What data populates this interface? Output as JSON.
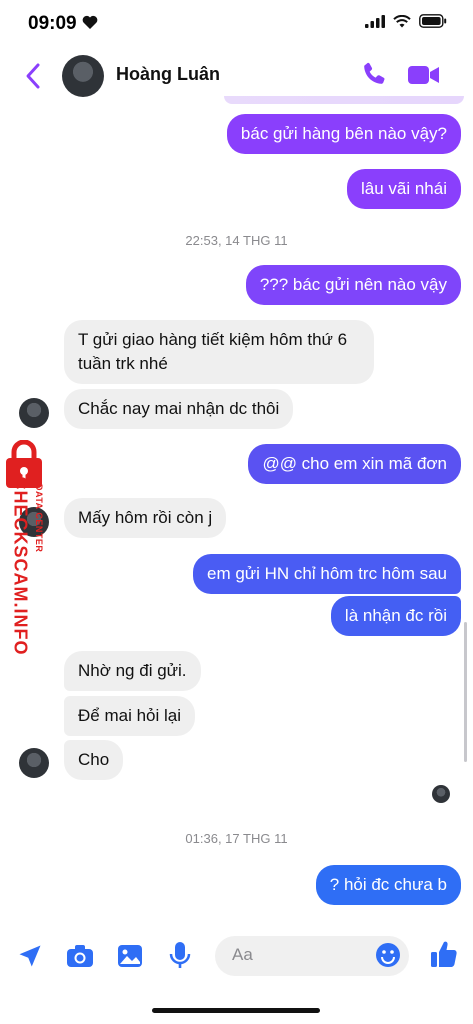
{
  "status_bar": {
    "time": "09:09"
  },
  "header": {
    "contact_name": "Hoàng Luân"
  },
  "messages": [
    {
      "text": "bác gửi hàng bên nào vậy?",
      "dir": "out"
    },
    {
      "text": "lâu vãi nhái",
      "dir": "out"
    },
    {
      "text": "??? bác gửi nên nào vậy",
      "dir": "out"
    },
    {
      "text": "T gửi giao hàng tiết kiệm hôm thứ 6",
      "text2": "tuần trk nhé",
      "dir": "in"
    },
    {
      "text": "Chắc nay mai nhận dc thôi",
      "dir": "in"
    },
    {
      "text": "@@ cho em xin mã đơn",
      "dir": "out"
    },
    {
      "text": "Mấy hôm rồi còn j",
      "dir": "in"
    },
    {
      "text": "em gửi HN chỉ hôm trc hôm sau",
      "dir": "out"
    },
    {
      "text": "là nhận đc rồi",
      "dir": "out"
    },
    {
      "text": "Nhờ ng đi gửi.",
      "dir": "in"
    },
    {
      "text": "Để mai hỏi lại",
      "dir": "in"
    },
    {
      "text": "Cho",
      "dir": "in"
    },
    {
      "text": "? hỏi đc chưa b",
      "dir": "out"
    }
  ],
  "timestamps": [
    "22:53, 14 THG 11",
    "01:36, 17 THG 11"
  ],
  "composer": {
    "placeholder": "Aa"
  },
  "watermark": {
    "brand": "CHECKSCAM.INFO",
    "sub": "DATA CENTER"
  },
  "icons": [
    "back-chevron-icon",
    "phone-icon",
    "video-icon",
    "send-location-icon",
    "camera-icon",
    "gallery-icon",
    "microphone-icon",
    "emoji-icon",
    "like-icon"
  ],
  "colors": {
    "accent": "#8a3ffc",
    "out_bubble_top": "#8a3ffc",
    "out_bubble_bottom": "#2f6ef5",
    "in_bubble": "#efefef",
    "watermark_red": "#e02020"
  }
}
